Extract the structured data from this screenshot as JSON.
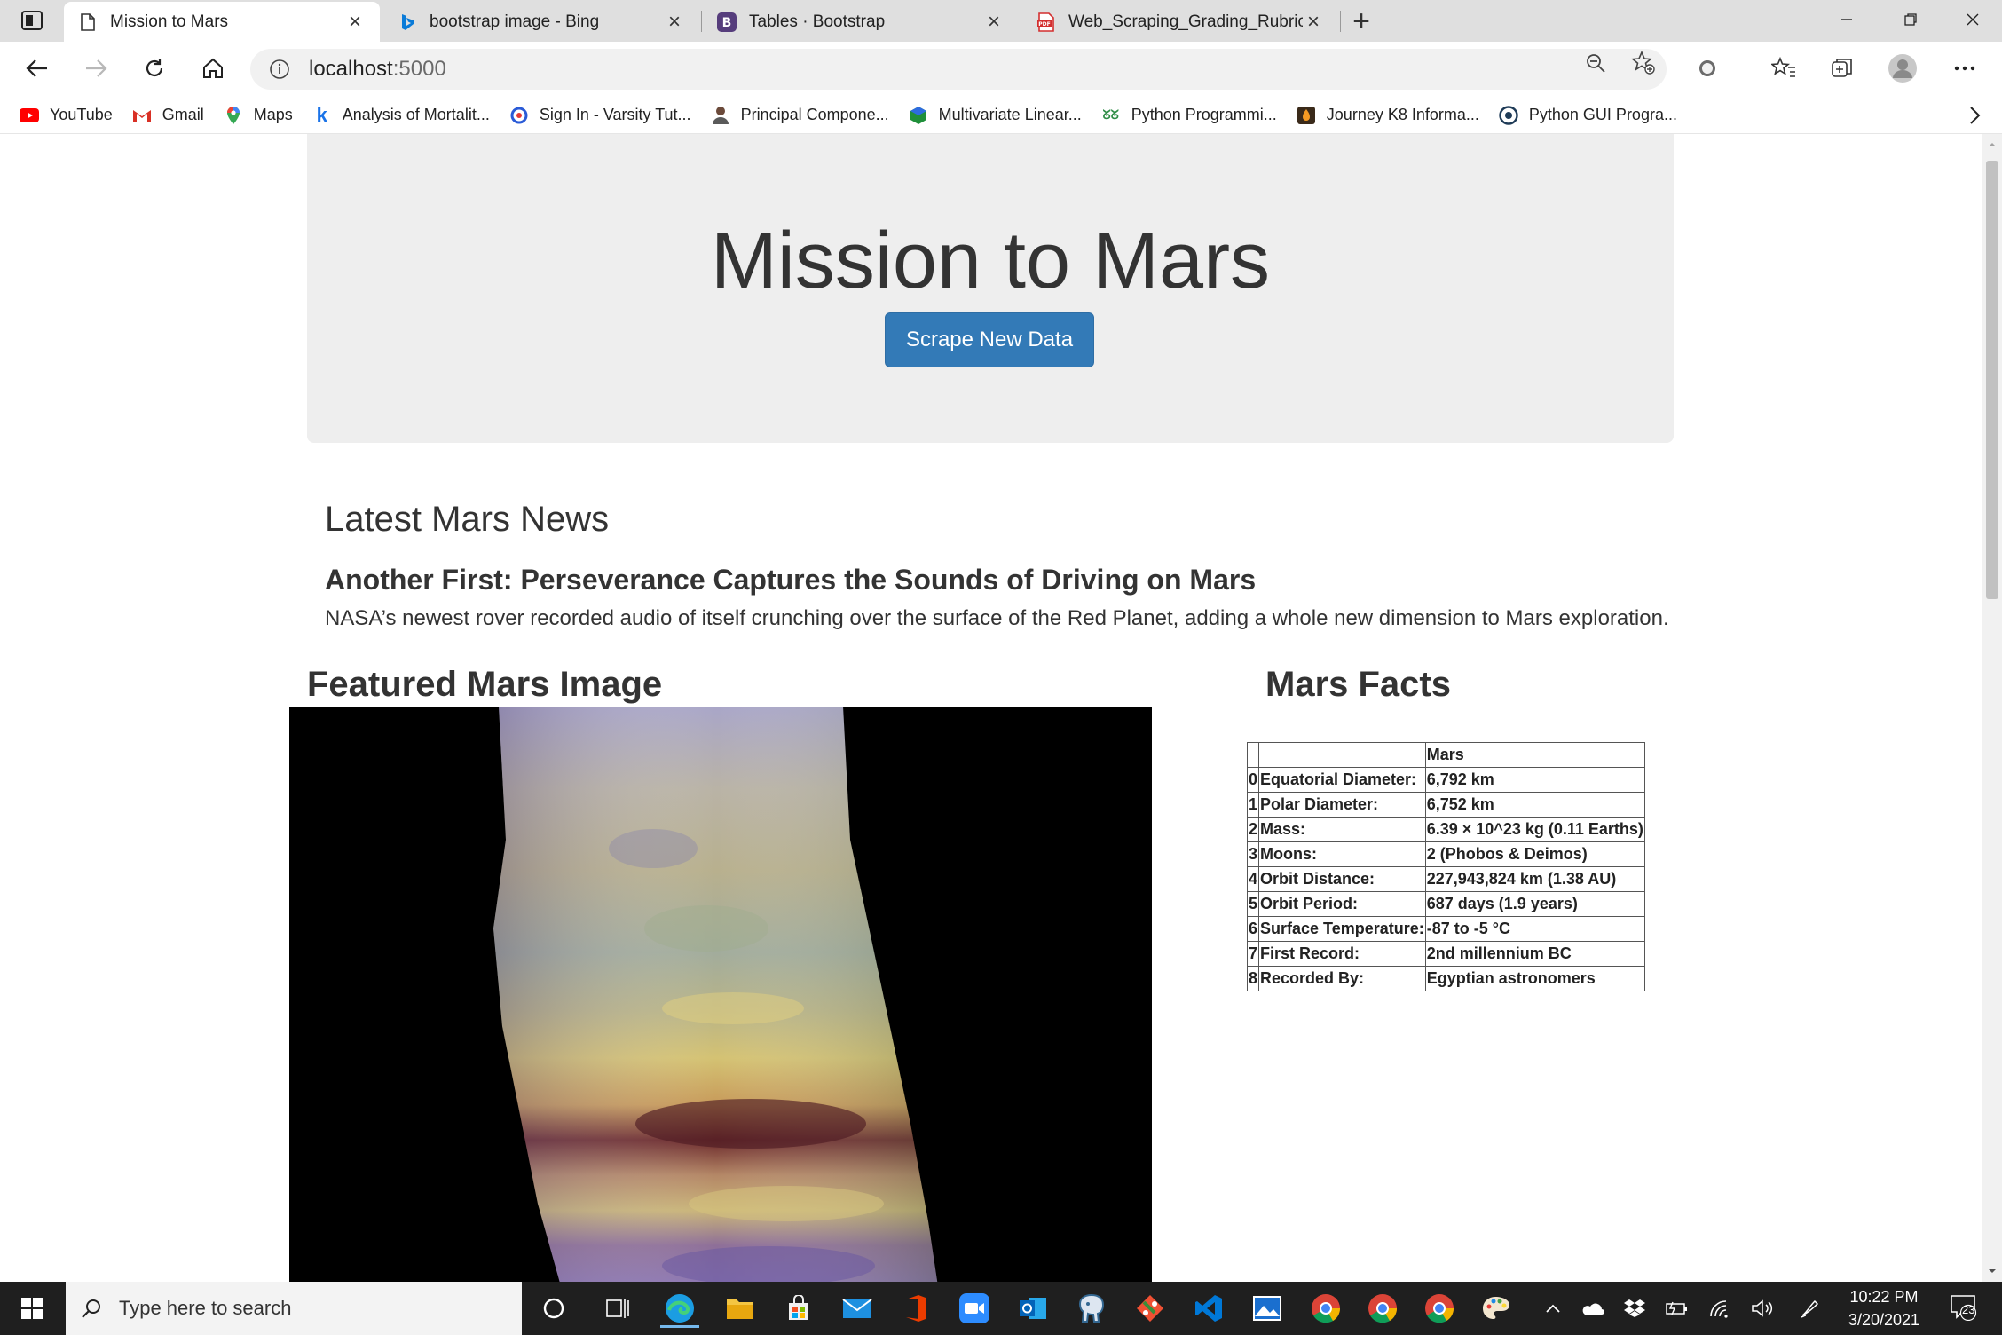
{
  "browser": {
    "tabs": [
      {
        "title": "Mission to Mars",
        "icon": "page-icon",
        "active": true
      },
      {
        "title": "bootstrap image - Bing",
        "icon": "bing-icon",
        "active": false
      },
      {
        "title": "Tables · Bootstrap",
        "icon": "bootstrap-icon",
        "active": false
      },
      {
        "title": "Web_Scraping_Grading_Rubric.p",
        "icon": "pdf-icon",
        "active": false
      }
    ],
    "url_host": "localhost",
    "url_port": ":5000",
    "bookmarks": [
      {
        "label": "YouTube",
        "icon": "youtube-icon"
      },
      {
        "label": "Gmail",
        "icon": "gmail-icon"
      },
      {
        "label": "Maps",
        "icon": "maps-icon"
      },
      {
        "label": "Analysis of Mortalit...",
        "icon": "k-icon"
      },
      {
        "label": "Sign In - Varsity Tut...",
        "icon": "varsity-icon"
      },
      {
        "label": "Principal Compone...",
        "icon": "person-icon"
      },
      {
        "label": "Multivariate Linear...",
        "icon": "hex-icon"
      },
      {
        "label": "Python Programmi...",
        "icon": "gfg-icon"
      },
      {
        "label": "Journey K8 Informa...",
        "icon": "journey-icon"
      },
      {
        "label": "Python GUI Progra...",
        "icon": "python-gui-icon"
      }
    ]
  },
  "page": {
    "title": "Mission to Mars",
    "scrape_button": "Scrape New Data",
    "news_heading": "Latest Mars News",
    "news_title": "Another First: Perseverance Captures the Sounds of Driving on Mars",
    "news_paragraph": "NASA’s newest rover recorded audio of itself crunching over the surface of the Red Planet, adding a whole new dimension to Mars exploration.",
    "featured_heading": "Featured Mars Image",
    "facts_heading": "Mars Facts",
    "facts_table": {
      "column": "Mars",
      "rows": [
        {
          "index": "0",
          "label": "Equatorial Diameter:",
          "value": "6,792 km"
        },
        {
          "index": "1",
          "label": "Polar Diameter:",
          "value": "6,752 km"
        },
        {
          "index": "2",
          "label": "Mass:",
          "value": "6.39 × 10^23 kg (0.11 Earths)"
        },
        {
          "index": "3",
          "label": "Moons:",
          "value": "2 (Phobos & Deimos)"
        },
        {
          "index": "4",
          "label": "Orbit Distance:",
          "value": "227,943,824 km (1.38 AU)"
        },
        {
          "index": "5",
          "label": "Orbit Period:",
          "value": "687 days (1.9 years)"
        },
        {
          "index": "6",
          "label": "Surface Temperature:",
          "value": "-87 to -5 °C"
        },
        {
          "index": "7",
          "label": "First Record:",
          "value": "2nd millennium BC"
        },
        {
          "index": "8",
          "label": "Recorded By:",
          "value": "Egyptian astronomers"
        }
      ]
    }
  },
  "taskbar": {
    "search_placeholder": "Type here to search",
    "time": "10:22 PM",
    "date": "3/20/2021",
    "notification_count": "23"
  },
  "colors": {
    "button_primary": "#337ab7",
    "jumbotron_bg": "#eeeeee",
    "taskbar_bg": "#1f1f1f"
  }
}
